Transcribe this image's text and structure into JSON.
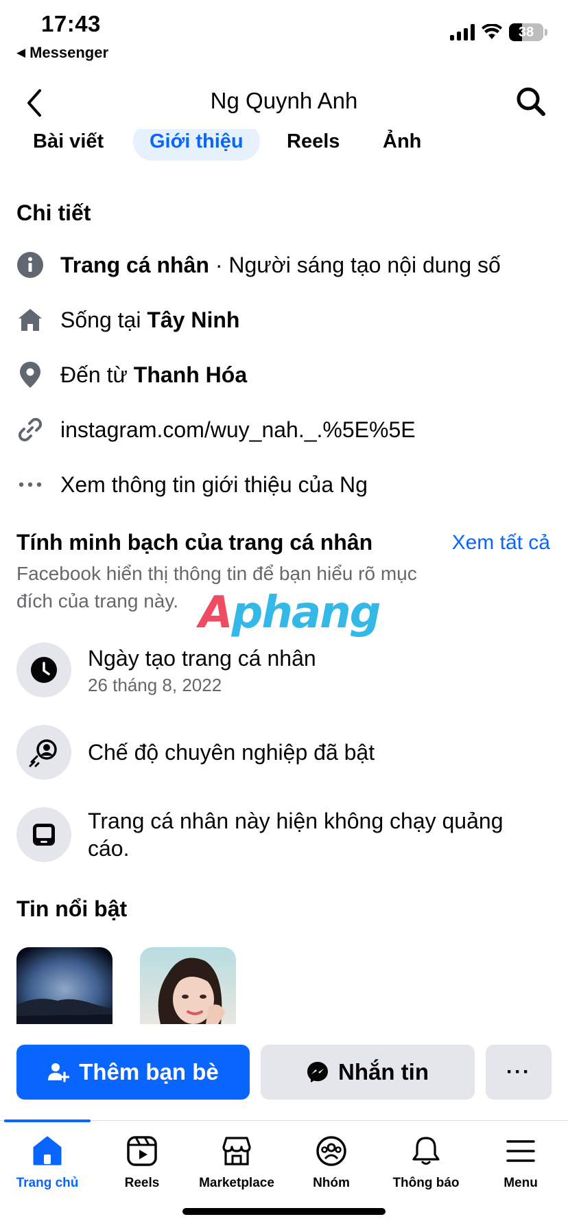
{
  "status_bar": {
    "time": "17:43",
    "back_app": "Messenger",
    "battery": "38"
  },
  "header": {
    "title": "Ng Quynh Anh"
  },
  "tabs": [
    {
      "label": "Bài viết",
      "active": false
    },
    {
      "label": "Giới thiệu",
      "active": true
    },
    {
      "label": "Reels",
      "active": false
    },
    {
      "label": "Ảnh",
      "active": false
    }
  ],
  "details": {
    "title": "Chi tiết",
    "profile_type_bold": "Trang cá nhân",
    "profile_type_rest": " · Người sáng tạo nội dung số",
    "lives_prefix": "Sống tại ",
    "lives_city": "Tây Ninh",
    "from_prefix": "Đến từ ",
    "from_city": "Thanh Hóa",
    "link": "instagram.com/wuy_nah._.%5E%5E",
    "see_about": "Xem thông tin giới thiệu của Ng"
  },
  "transparency": {
    "title": "Tính minh bạch của trang cá nhân",
    "see_all": "Xem tất cả",
    "description": "Facebook hiển thị thông tin để bạn hiểu rõ mục đích của trang này.",
    "created_label": "Ngày tạo trang cá nhân",
    "created_date": "26 tháng 8, 2022",
    "professional_mode": "Chế độ chuyên nghiệp đã bật",
    "no_ads": "Trang cá nhân này hiện không chạy quảng cáo."
  },
  "watermark": {
    "first": "A",
    "rest": "phang"
  },
  "highlights": {
    "title": "Tin nổi bật"
  },
  "actions": {
    "add_friend": "Thêm bạn bè",
    "message": "Nhắn tin",
    "more": "···"
  },
  "bottom_nav": [
    {
      "label": "Trang chủ",
      "icon": "home-icon",
      "active": true
    },
    {
      "label": "Reels",
      "icon": "reels-icon",
      "active": false
    },
    {
      "label": "Marketplace",
      "icon": "marketplace-icon",
      "active": false
    },
    {
      "label": "Nhóm",
      "icon": "groups-icon",
      "active": false
    },
    {
      "label": "Thông báo",
      "icon": "bell-icon",
      "active": false
    },
    {
      "label": "Menu",
      "icon": "menu-icon",
      "active": false
    }
  ],
  "colors": {
    "accent": "#0866ff",
    "muted_text": "#65676b",
    "chip_bg": "#e4e6eb"
  }
}
